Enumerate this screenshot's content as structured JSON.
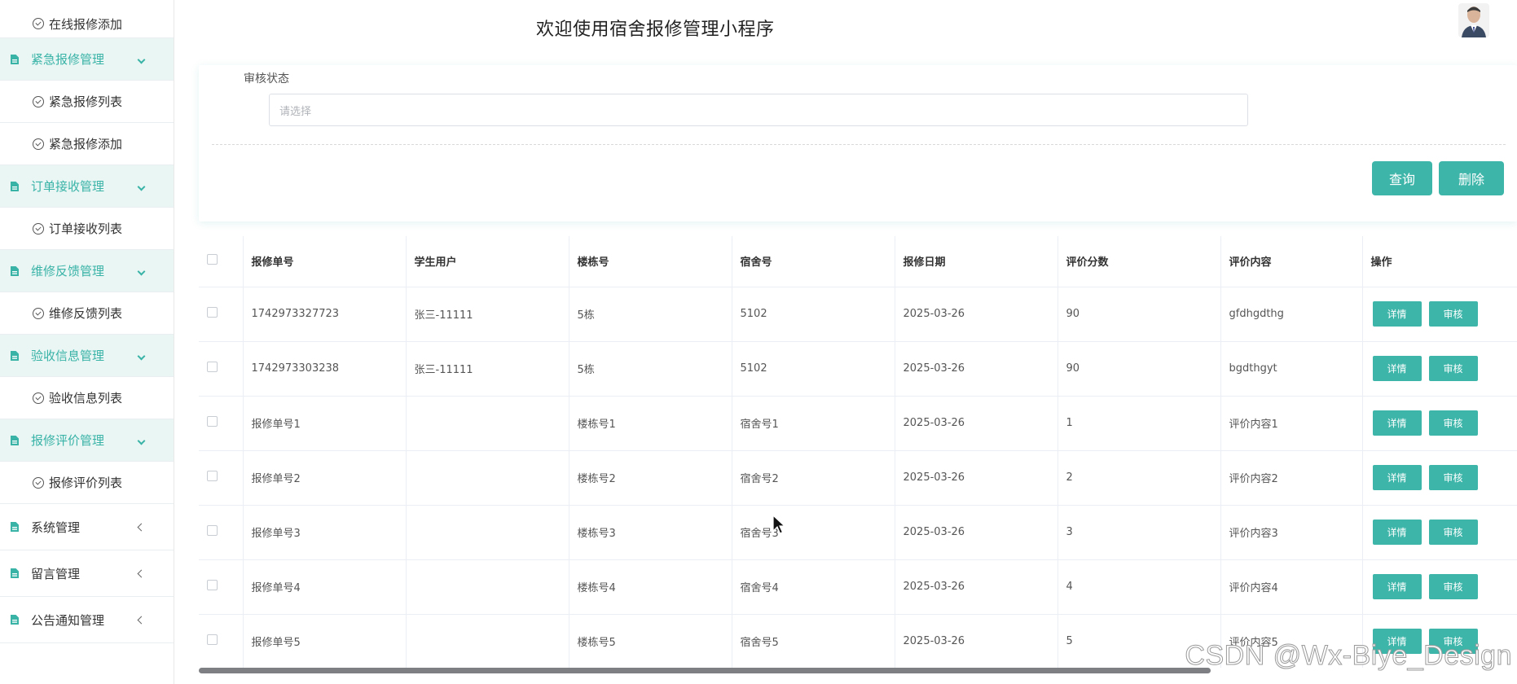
{
  "header": {
    "title": "欢迎使用宿舍报修管理小程序"
  },
  "sidebar": {
    "items": [
      {
        "type": "sub",
        "label": "在线报修添加"
      },
      {
        "type": "group",
        "label": "紧急报修管理",
        "expanded": true
      },
      {
        "type": "sub",
        "label": "紧急报修列表"
      },
      {
        "type": "sub",
        "label": "紧急报修添加"
      },
      {
        "type": "group",
        "label": "订单接收管理",
        "expanded": true
      },
      {
        "type": "sub",
        "label": "订单接收列表"
      },
      {
        "type": "group",
        "label": "维修反馈管理",
        "expanded": true
      },
      {
        "type": "sub",
        "label": "维修反馈列表"
      },
      {
        "type": "group",
        "label": "验收信息管理",
        "expanded": true
      },
      {
        "type": "sub",
        "label": "验收信息列表"
      },
      {
        "type": "group",
        "label": "报修评价管理",
        "expanded": true
      },
      {
        "type": "sub",
        "label": "报修评价列表"
      },
      {
        "type": "plain",
        "label": "系统管理",
        "expanded": false
      },
      {
        "type": "plain",
        "label": "留言管理",
        "expanded": false
      },
      {
        "type": "plain",
        "label": "公告通知管理",
        "expanded": false
      }
    ]
  },
  "search": {
    "status_label": "审核状态",
    "status_placeholder": "请选择",
    "query_label": "查询",
    "delete_label": "删除"
  },
  "table": {
    "columns": [
      "报修单号",
      "学生用户",
      "楼栋号",
      "宿舍号",
      "报修日期",
      "评价分数",
      "评价内容",
      "操作"
    ],
    "rows": [
      {
        "order_no": "1742973327723",
        "student": "张三-11111",
        "building": "5栋",
        "room": "5102",
        "date": "2025-03-26",
        "score": "90",
        "content": "gfdhgdthg"
      },
      {
        "order_no": "1742973303238",
        "student": "张三-11111",
        "building": "5栋",
        "room": "5102",
        "date": "2025-03-26",
        "score": "90",
        "content": "bgdthgyt"
      },
      {
        "order_no": "报修单号1",
        "student": "",
        "building": "楼栋号1",
        "room": "宿舍号1",
        "date": "2025-03-26",
        "score": "1",
        "content": "评价内容1"
      },
      {
        "order_no": "报修单号2",
        "student": "",
        "building": "楼栋号2",
        "room": "宿舍号2",
        "date": "2025-03-26",
        "score": "2",
        "content": "评价内容2"
      },
      {
        "order_no": "报修单号3",
        "student": "",
        "building": "楼栋号3",
        "room": "宿舍号3",
        "date": "2025-03-26",
        "score": "3",
        "content": "评价内容3"
      },
      {
        "order_no": "报修单号4",
        "student": "",
        "building": "楼栋号4",
        "room": "宿舍号4",
        "date": "2025-03-26",
        "score": "4",
        "content": "评价内容4"
      },
      {
        "order_no": "报修单号5",
        "student": "",
        "building": "楼栋号5",
        "room": "宿舍号5",
        "date": "2025-03-26",
        "score": "5",
        "content": "评价内容5"
      }
    ],
    "row_actions": {
      "detail_label": "详情",
      "audit_label": "审核"
    }
  },
  "watermark": "CSDN @Wx-Biye_Design",
  "colors": {
    "accent": "#3db5a9",
    "sidebar_group_bg": "#e9f6f4"
  },
  "icons": {
    "group": "file-icon",
    "sub": "check-circle-icon",
    "avatar": "user-avatar"
  }
}
